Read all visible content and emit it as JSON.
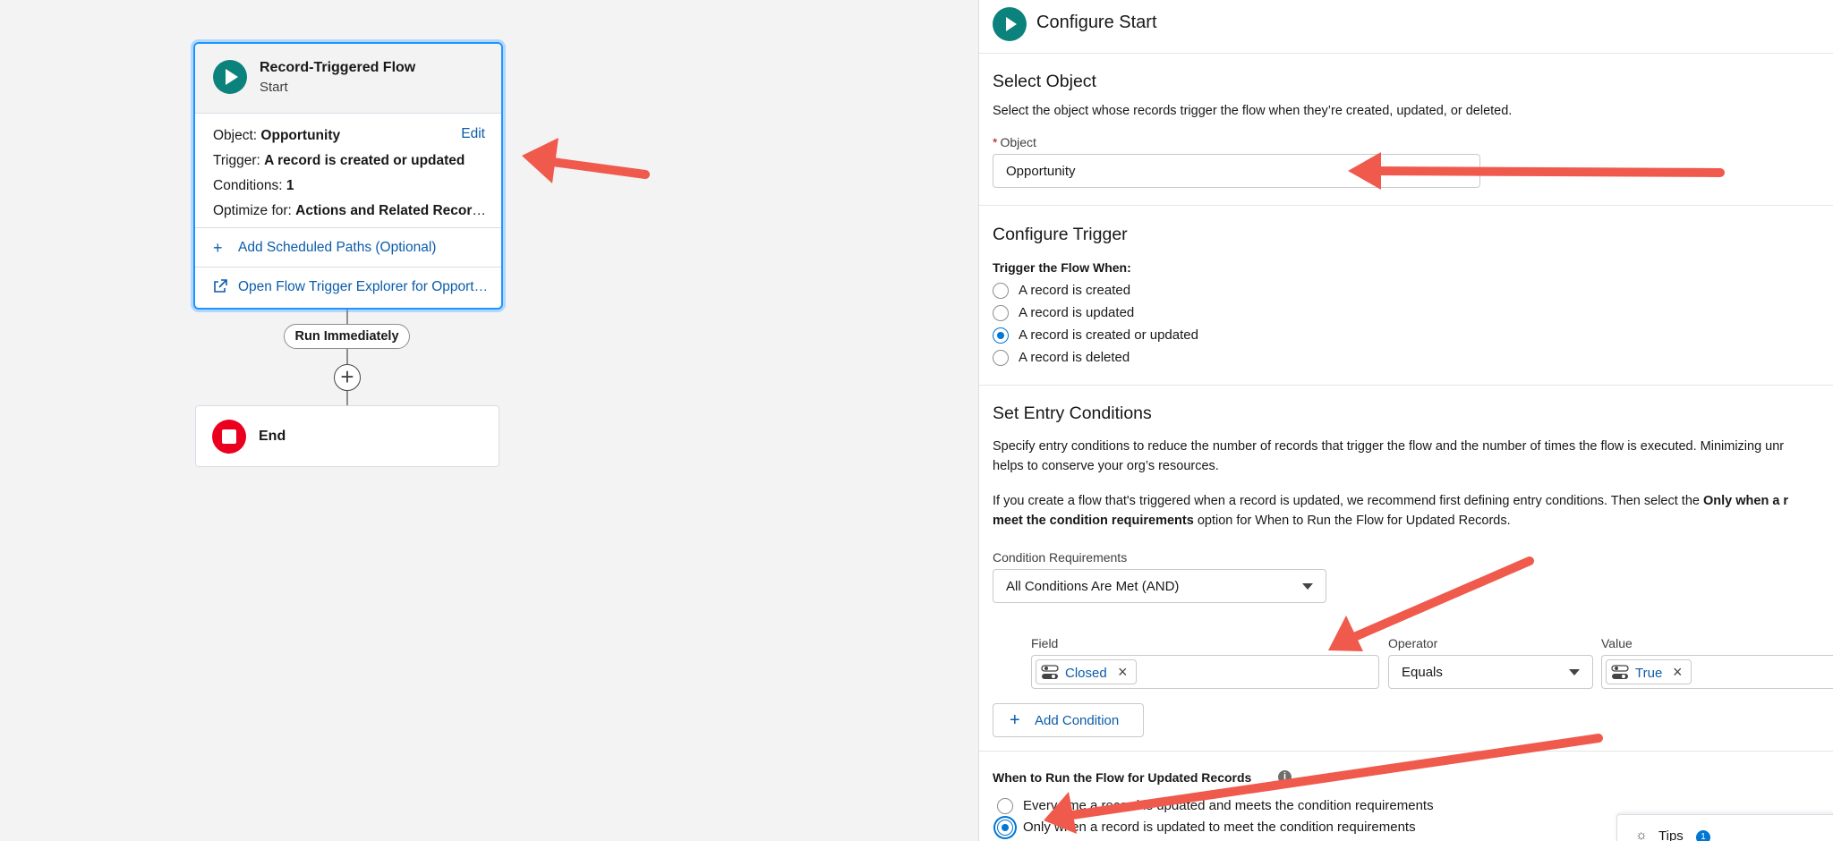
{
  "canvas": {
    "start_card": {
      "title": "Record-Triggered Flow",
      "subtitle": "Start",
      "object_label": "Object:",
      "object_value": "Opportunity",
      "edit_label": "Edit",
      "trigger_label": "Trigger:",
      "trigger_value": "A record is created or updated",
      "conditions_label": "Conditions:",
      "conditions_value": "1",
      "optimize_label": "Optimize for:",
      "optimize_value": "Actions and Related Records",
      "add_paths_label": "Add Scheduled Paths (Optional)",
      "explorer_label": "Open Flow Trigger Explorer for Opportunity"
    },
    "run_immediately_label": "Run Immediately",
    "end_label": "End"
  },
  "panel": {
    "title": "Configure Start",
    "select_object": {
      "heading": "Select Object",
      "description": "Select the object whose records trigger the flow when they’re created, updated, or deleted.",
      "field_label": "Object",
      "field_value": "Opportunity"
    },
    "configure_trigger": {
      "heading": "Configure Trigger",
      "trigger_label": "Trigger the Flow When:",
      "options": [
        {
          "label": "A record is created",
          "selected": false
        },
        {
          "label": "A record is updated",
          "selected": false
        },
        {
          "label": "A record is created or updated",
          "selected": true
        },
        {
          "label": "A record is deleted",
          "selected": false
        }
      ]
    },
    "entry_conditions": {
      "heading": "Set Entry Conditions",
      "para1_line1": "Specify entry conditions to reduce the number of records that trigger the flow and the number of times the flow is executed. Minimizing unr",
      "para1_line2": "helps to conserve your org’s resources.",
      "para2_line1_a": "If you create a flow that's triggered when a record is updated, we recommend first defining entry conditions. Then select the ",
      "para2_line1_b": "Only when a r",
      "para2_line2_a": "meet the condition requirements",
      "para2_line2_b": " option for When to Run the Flow for Updated Records.",
      "requirements_label": "Condition Requirements",
      "requirements_value": "All Conditions Are Met (AND)",
      "field_col": "Field",
      "operator_col": "Operator",
      "value_col": "Value",
      "field_value": "Closed",
      "operator_value": "Equals",
      "value_value": "True",
      "add_condition_label": "Add Condition"
    },
    "when_to_run": {
      "heading": "When to Run the Flow for Updated Records",
      "options": [
        {
          "label": "Every time a record is updated and meets the condition requirements",
          "selected": false
        },
        {
          "label": "Only when a record is updated to meet the condition requirements",
          "selected": true
        }
      ]
    },
    "tips": {
      "label": "Tips",
      "count": "1"
    }
  },
  "colors": {
    "accent": "#0176d3",
    "link": "#0b5cab",
    "start_icon": "#0b827c",
    "end_icon": "#ea001e",
    "annotation_arrow": "#ef5a4c"
  }
}
